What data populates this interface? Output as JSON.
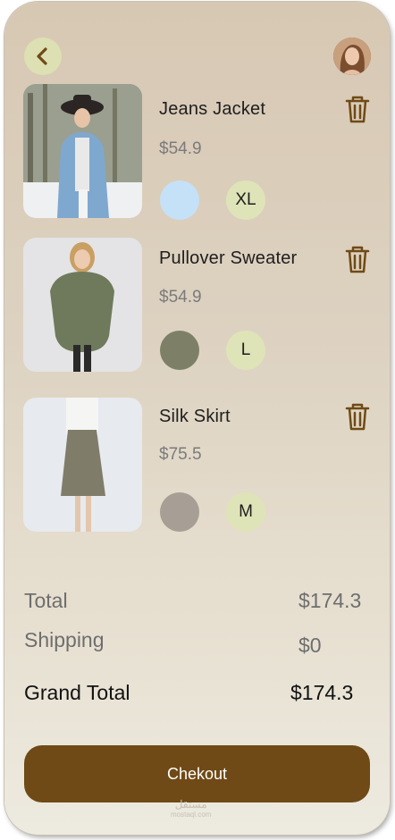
{
  "header": {
    "back_icon": "chevron-left-icon",
    "avatar": "user-avatar"
  },
  "colors": {
    "accent": "#6f4a16",
    "size_badge": "#dfe4b8",
    "back_button": "#dce0b3"
  },
  "cart": {
    "items": [
      {
        "name": "Jeans Jacket",
        "price": "$54.9",
        "color": "#c5e1f8",
        "size": "XL"
      },
      {
        "name": "Pullover Sweater",
        "price": "$54.9",
        "color": "#7d8066",
        "size": "L"
      },
      {
        "name": "Silk Skirt",
        "price": "$75.5",
        "color": "#a79e95",
        "size": "M"
      }
    ]
  },
  "summary": {
    "total_label": "Total",
    "total_value": "$174.3",
    "shipping_label": "Shipping",
    "shipping_value": "$0",
    "grand_label": "Grand Total",
    "grand_value": "$174.3"
  },
  "checkout_label": "Chekout",
  "watermark": {
    "line1": "مستقل",
    "line2": "mostaql.com"
  }
}
